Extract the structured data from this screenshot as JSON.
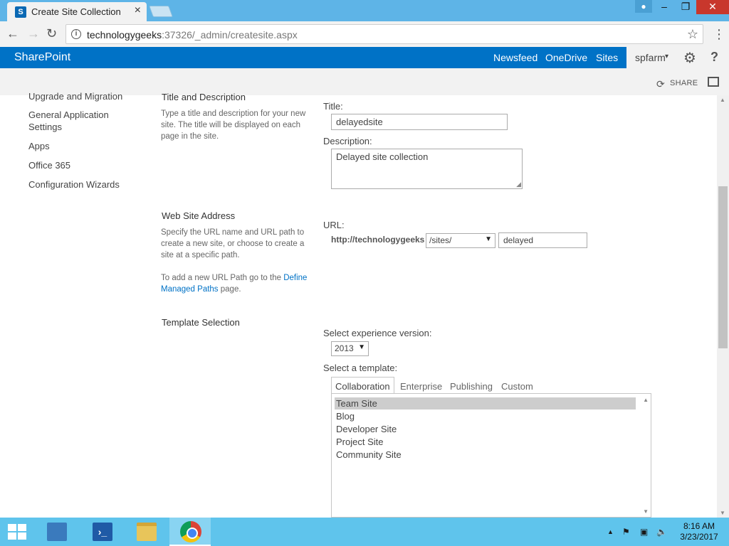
{
  "browser": {
    "tab_title": "Create Site Collection",
    "url_host": "technologygeeks",
    "url_rest": ":37326/_admin/createsite.aspx"
  },
  "suitebar": {
    "brand": "SharePoint",
    "links": [
      "Newsfeed",
      "OneDrive",
      "Sites"
    ],
    "user": "spfarm",
    "share": "SHARE"
  },
  "leftnav": {
    "items": [
      "Upgrade and Migration",
      "General Application",
      "Settings",
      "Apps",
      "Office 365",
      "Configuration Wizards"
    ]
  },
  "sections": {
    "title_desc": {
      "heading": "Title and Description",
      "description": "Type a title and description for your new site. The title will be displayed on each page in the site.",
      "title_label": "Title:",
      "title_value": "delayedsite",
      "desc_label": "Description:",
      "desc_value": "Delayed site collection"
    },
    "web_address": {
      "heading": "Web Site Address",
      "description": "Specify the URL name and URL path to create a new site, or choose to create a site at a specific path.",
      "managed_prefix": "To add a new URL Path go to the",
      "managed_link": "Define Managed Paths",
      "managed_suffix": "page.",
      "url_label": "URL:",
      "url_prefix": "http://technologygeeks",
      "path_value": "/sites/",
      "name_value": "delayed"
    },
    "template": {
      "heading": "Template Selection",
      "version_label": "Select experience version:",
      "version_value": "2013",
      "template_label": "Select a template:",
      "tabs": [
        "Collaboration",
        "Enterprise",
        "Publishing",
        "Custom"
      ],
      "items": [
        "Team Site",
        "Blog",
        "Developer Site",
        "Project Site",
        "Community Site"
      ]
    }
  },
  "taskbar": {
    "time": "8:16 AM",
    "date": "3/23/2017"
  },
  "colors": {
    "suitebar": "#0072c6",
    "taskbar": "#5fc4ec",
    "titlebar": "#5eb4e7"
  }
}
